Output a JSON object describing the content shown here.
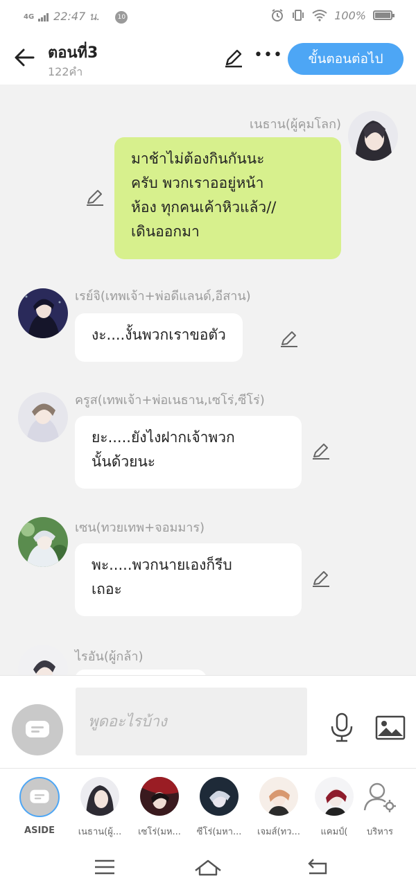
{
  "status_bar": {
    "network": "4G",
    "time": "22:47 น.",
    "notification_count": "10",
    "battery": "100%"
  },
  "header": {
    "title": "ตอนที่3",
    "word_count": "122คำ",
    "next_button": "ขั้นตอนต่อไป"
  },
  "messages": [
    {
      "speaker": "เนธาน(ผู้คุมโลก)",
      "side": "right",
      "bubble_color": "#d7f08d",
      "lines": [
        "มาช้าไม่ต้องกินกันนะ",
        "ครับ พวกเราออยู่หน้า",
        "ห้อง ทุกคนเค้าหิวแล้ว//",
        "เดินออกมา"
      ]
    },
    {
      "speaker": "เรย์จิ(เทพเจ้า+พ่อดีแลนด์,อีสาน)",
      "side": "left",
      "bubble_color": "#ffffff",
      "lines": [
        "งะ....งั้นพวกเราขอตัว"
      ]
    },
    {
      "speaker": "ครูส(เทพเจ้า+พ่อเนธาน,เซโร่,ซีโร่)",
      "side": "left",
      "bubble_color": "#ffffff",
      "lines": [
        "ยะ.....ยังไงฝากเจ้าพวก",
        "นั้นด้วยนะ"
      ]
    },
    {
      "speaker": "เซน(ทวยเทพ+จอมมาร)",
      "side": "left",
      "bubble_color": "#ffffff",
      "lines": [
        "พะ.....พวกนายเองก็รีบ",
        "เถอะ"
      ]
    },
    {
      "speaker": "ไรอัน(ผู้กล้า)",
      "side": "left",
      "bubble_color": "#ffffff",
      "lines": []
    }
  ],
  "composer": {
    "placeholder": "พูดอะไรบ้าง"
  },
  "characters": [
    {
      "label": "ASIDE"
    },
    {
      "label": "เนธาน(ผู้..."
    },
    {
      "label": "เซโร่(มห..."
    },
    {
      "label": "ซีโร่(มหา..."
    },
    {
      "label": "เจมส์(ทว..."
    },
    {
      "label": "แคมป์("
    },
    {
      "label": "บริหาร"
    }
  ],
  "colors": {
    "accent": "#4da6f5",
    "green_bubble": "#d7f08d",
    "background": "#f2f2f2"
  },
  "icons": [
    "back-arrow-icon",
    "pencil-icon",
    "more-icon",
    "microphone-icon",
    "image-icon",
    "aside-chat-icon",
    "manage-user-icon",
    "menu-icon",
    "home-icon",
    "back-nav-icon"
  ]
}
